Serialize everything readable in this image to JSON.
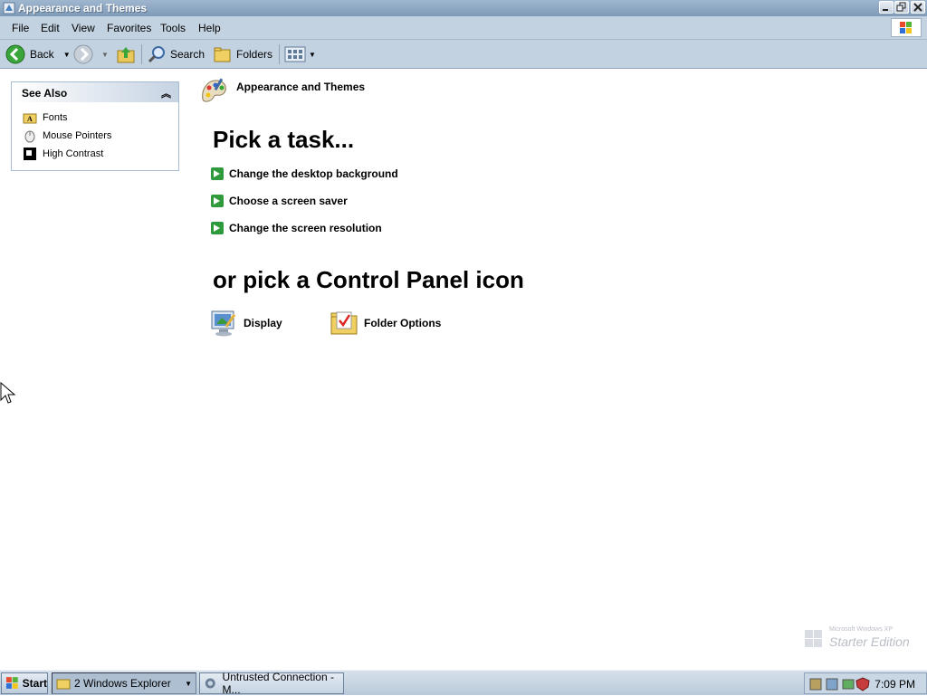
{
  "window": {
    "title": "Appearance and Themes",
    "controls": {
      "minimize": "_",
      "maximize": "□",
      "close": "✕"
    }
  },
  "menubar": {
    "items": [
      "File",
      "Edit",
      "View",
      "Favorites",
      "Tools",
      "Help"
    ]
  },
  "toolbar": {
    "back_label": "Back",
    "search_label": "Search",
    "folders_label": "Folders"
  },
  "see_also": {
    "title": "See Also",
    "items": [
      {
        "label": "Fonts",
        "icon": "fonts-folder-icon"
      },
      {
        "label": "Mouse Pointers",
        "icon": "mouse-icon"
      },
      {
        "label": "High Contrast",
        "icon": "high-contrast-icon"
      }
    ]
  },
  "main": {
    "category_title": "Appearance and Themes",
    "pick_task_heading": "Pick a task...",
    "tasks": [
      "Change the desktop background",
      "Choose a screen saver",
      "Change the screen resolution"
    ],
    "pick_icon_heading": "or pick a Control Panel icon",
    "icons": [
      {
        "label": "Display",
        "icon": "display-icon"
      },
      {
        "label": "Folder Options",
        "icon": "folder-options-icon"
      }
    ]
  },
  "watermark": {
    "line1": "Microsoft Windows XP",
    "line2": "Starter Edition"
  },
  "taskbar": {
    "start_label": "Start",
    "buttons": [
      {
        "label": "2 Windows Explorer",
        "active": true
      },
      {
        "label": "Untrusted Connection - M..."
      }
    ],
    "clock": "7:09 PM"
  }
}
